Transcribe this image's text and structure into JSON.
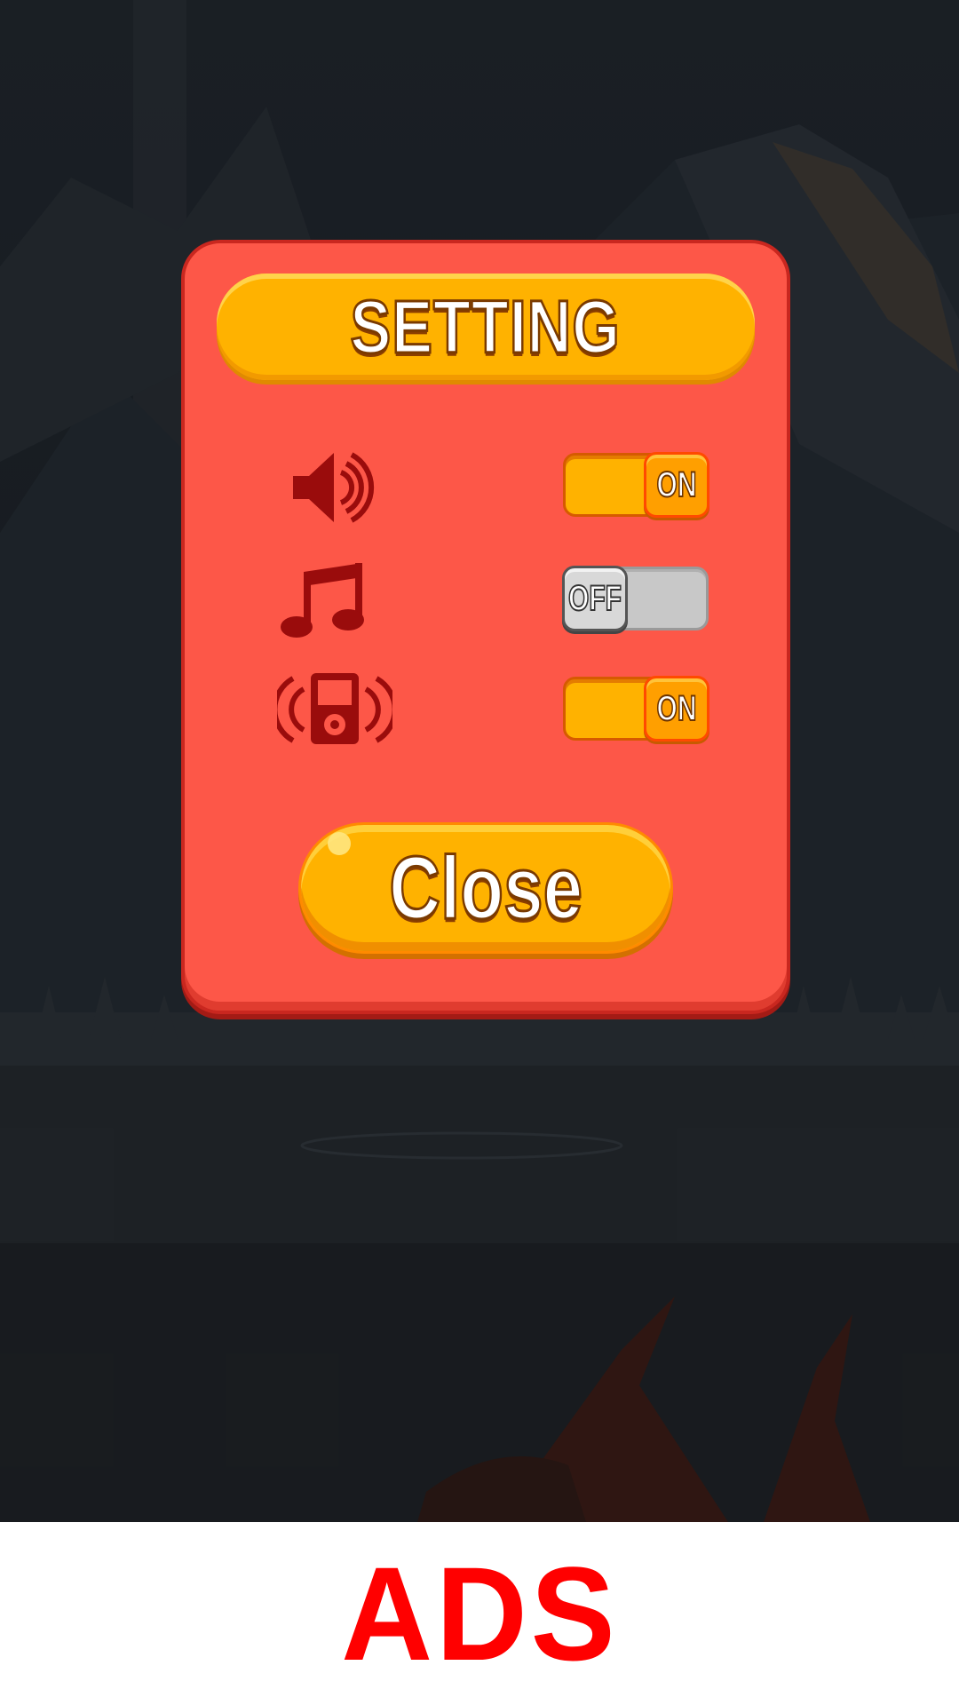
{
  "dialog": {
    "title": "SETTING",
    "settings": [
      {
        "icon": "speaker-icon",
        "state": "ON",
        "enabled": true
      },
      {
        "icon": "music-note-icon",
        "state": "OFF",
        "enabled": false
      },
      {
        "icon": "vibration-icon",
        "state": "ON",
        "enabled": true
      }
    ],
    "close_label": "Close"
  },
  "ads": {
    "label": "ADS"
  },
  "colors": {
    "panel": "#fd5748",
    "accent": "#ffb200",
    "icon": "#9a0c0c",
    "ads_text": "#ff0000"
  }
}
